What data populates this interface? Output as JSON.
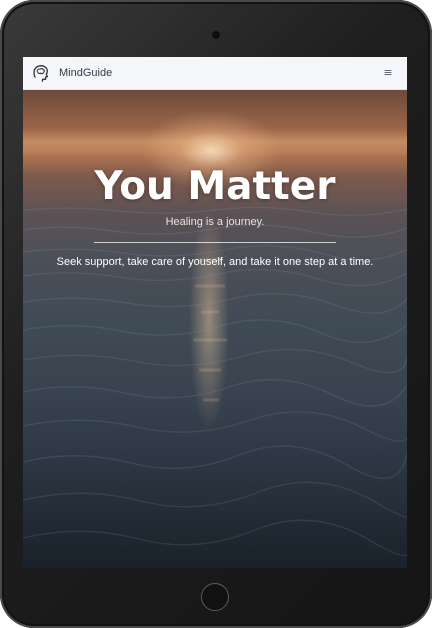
{
  "app": {
    "brand_name": "MindGuide"
  },
  "navbar": {
    "logo_icon": "head-brain-icon",
    "menu_icon": "hamburger-menu-icon",
    "menu_glyph": "≡"
  },
  "hero": {
    "title": "You Matter",
    "subtitle": "Healing is a journey.",
    "message": "Seek support, take care of youself, and take it one step at a time.",
    "background": "sunset-ocean-image"
  },
  "colors": {
    "navbar_bg": "#f4f6f9",
    "hero_text": "#ffffff",
    "device_frame": "#1e1e1e"
  }
}
